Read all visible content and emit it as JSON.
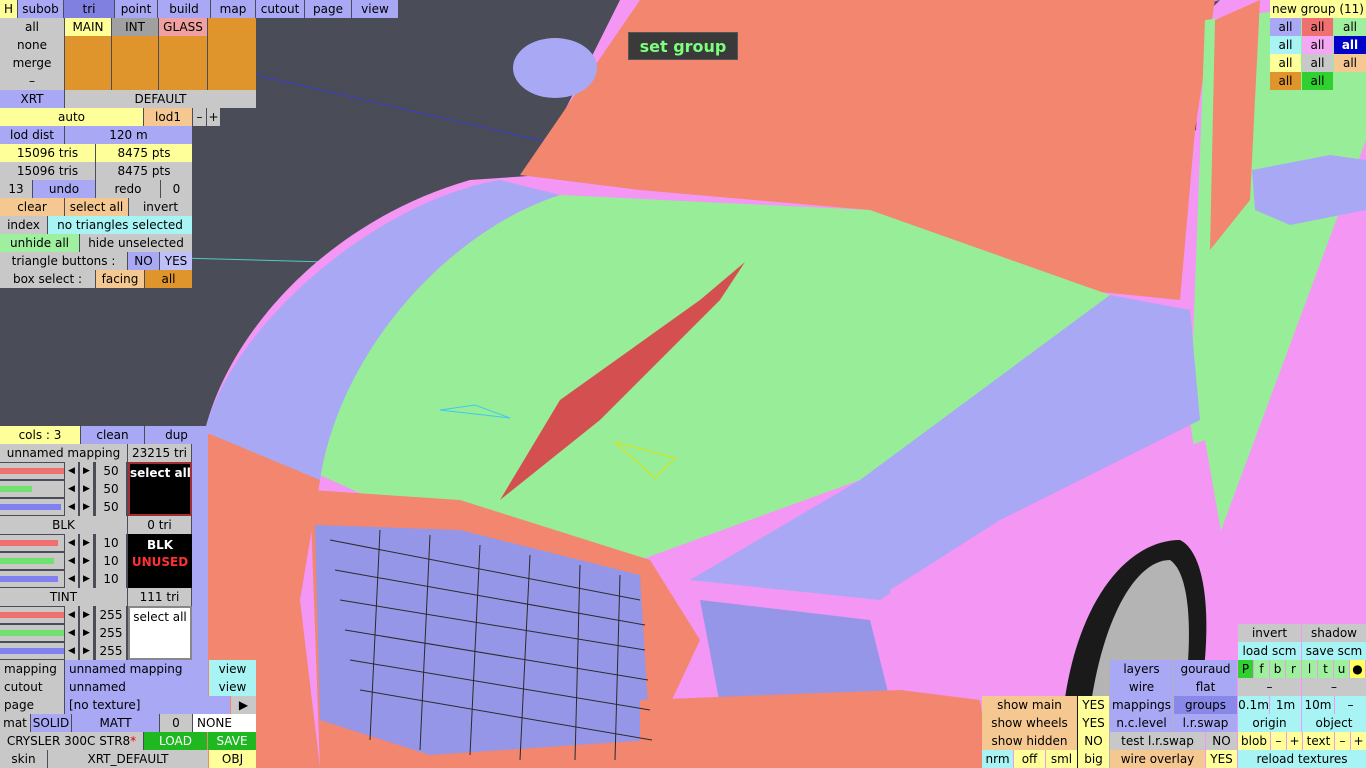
{
  "top": {
    "h": "H",
    "tabs": [
      "subob",
      "tri",
      "point",
      "build",
      "map",
      "cutout",
      "page",
      "view"
    ],
    "active": "tri"
  },
  "subob": {
    "all": "all",
    "none": "none",
    "merge": "merge",
    "dash": "–",
    "groups": [
      "MAIN",
      "INT",
      "GLASS"
    ],
    "xrt": "XRT",
    "default": "DEFAULT"
  },
  "lod": {
    "auto": "auto",
    "lod1": "lod1",
    "minus": "–",
    "plus": "+",
    "dist_label": "lod dist",
    "dist": "120 m",
    "tris1": "15096 tris",
    "pts1": "8475 pts",
    "tris2": "15096 tris",
    "pts2": "8475 pts",
    "undo_n": "13",
    "undo": "undo",
    "redo": "redo",
    "redo_n": "0"
  },
  "sel": {
    "clear": "clear",
    "select_all": "select all",
    "invert": "invert",
    "index": "index",
    "status": "no triangles selected",
    "unhide": "unhide all",
    "hide_unsel": "hide unselected",
    "tb_label": "triangle buttons :",
    "no": "NO",
    "yes": "YES",
    "box_label": "box select :",
    "facing": "facing",
    "all": "all"
  },
  "tooltip": "set group",
  "cols": {
    "label": "cols : 3",
    "clean": "clean",
    "dup": "dup",
    "m1": {
      "name": "unnamed mapping",
      "tri": "23215 tri",
      "v": [
        "50",
        "50",
        "50"
      ],
      "sw": "select all",
      "c": [
        "#f07070",
        "#70e070",
        "#8080f0"
      ],
      "f": [
        1,
        0.5,
        0.95
      ]
    },
    "m2": {
      "name": "BLK",
      "tri": "0 tri",
      "v": [
        "10",
        "10",
        "10"
      ],
      "sw1": "BLK",
      "sw2": "UNUSED",
      "c": [
        "#f07070",
        "#70e070",
        "#8080f0"
      ],
      "f": [
        0.9,
        0.85,
        0.9
      ]
    },
    "m3": {
      "name": "TINT",
      "tri": "111 tri",
      "v": [
        "255",
        "255",
        "255"
      ],
      "sw": "select all",
      "c": [
        "#f07070",
        "#70e070",
        "#8080f0"
      ],
      "f": [
        1,
        1,
        1
      ]
    }
  },
  "bot": {
    "mapping": "mapping",
    "mapping_v": "unnamed mapping",
    "view": "view",
    "cutout": "cutout",
    "cutout_v": "unnamed",
    "page": "page",
    "page_v": "[no texture]",
    "arrow": "▶",
    "mat": "mat",
    "solid": "SOLID",
    "matt": "MATT",
    "zero": "0",
    "none": "NONE",
    "name": "CRYSLER 300C STR8",
    "star": "*",
    "load": "LOAD",
    "save": "SAVE",
    "skin": "skin",
    "skin_v": "XRT_DEFAULT",
    "obj": "OBJ"
  },
  "rt": {
    "title": "new group (11)",
    "cells": [
      [
        "all",
        "all",
        "all"
      ],
      [
        "all",
        "all",
        "all"
      ],
      [
        "all",
        "all",
        "all"
      ],
      [
        "all",
        "all"
      ]
    ]
  },
  "rb": {
    "invert": "invert",
    "shadow": "shadow",
    "load_scm": "load scm",
    "save_scm": "save scm",
    "layers": "layers",
    "gouraud": "gouraud",
    "flags": [
      "P",
      "f",
      "b",
      "r",
      "l",
      "t",
      "u",
      "●"
    ],
    "wire": "wire",
    "flat": "flat",
    "mappings": "mappings",
    "groups": "groups",
    "z": [
      "0.1m",
      "1m",
      "10m",
      "–"
    ],
    "nc": "n.c.level",
    "lrswap": "l.r.swap",
    "origin": "origin",
    "object": "object",
    "show_main": "show main",
    "yes": "YES",
    "show_wheels": "show wheels",
    "show_hidden": "show hidden",
    "no": "NO",
    "test": "test l.r.swap",
    "blob": "blob",
    "minus": "–",
    "plus": "+",
    "text": "text",
    "nrm": "nrm",
    "off": "off",
    "sml": "sml",
    "big": "big",
    "wire_overlay": "wire overlay",
    "reload": "reload textures"
  }
}
